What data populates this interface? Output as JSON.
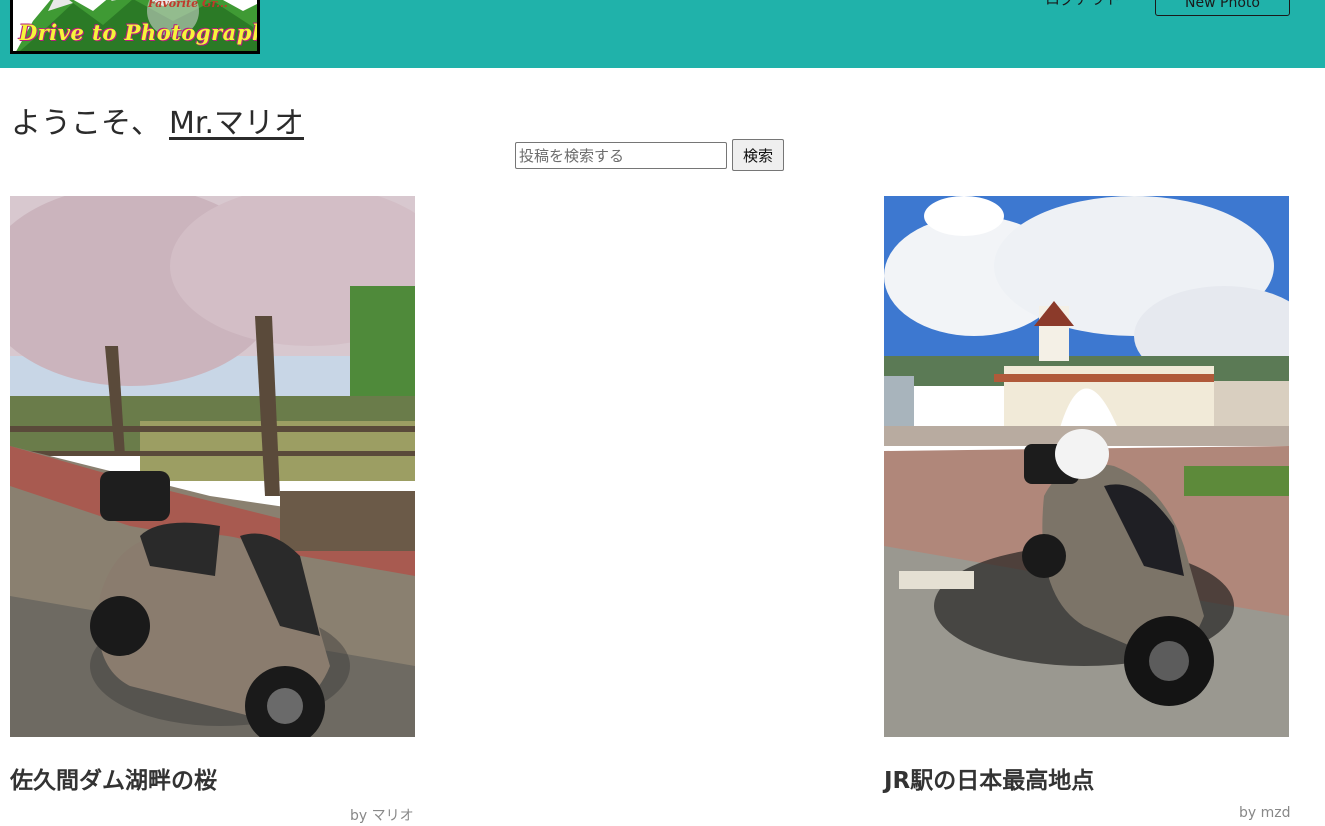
{
  "header": {
    "logo_title": "Drive to Photograph",
    "logo_subtitle": "Favorite Gr...",
    "logout_label": "ログアウト",
    "new_photo_label": "New Photo"
  },
  "welcome": {
    "greeting": "ようこそ、",
    "username": "Mr.マリオ"
  },
  "search": {
    "placeholder": "投稿を検索する",
    "button_label": "検索"
  },
  "posts": [
    {
      "title": "佐久間ダム湖畔の桜",
      "author": "by マリオ"
    },
    {
      "title": "JR駅の日本最高地点",
      "author": "by mzd"
    }
  ],
  "colors": {
    "header_bg": "#20b2aa",
    "text": "#333333"
  }
}
